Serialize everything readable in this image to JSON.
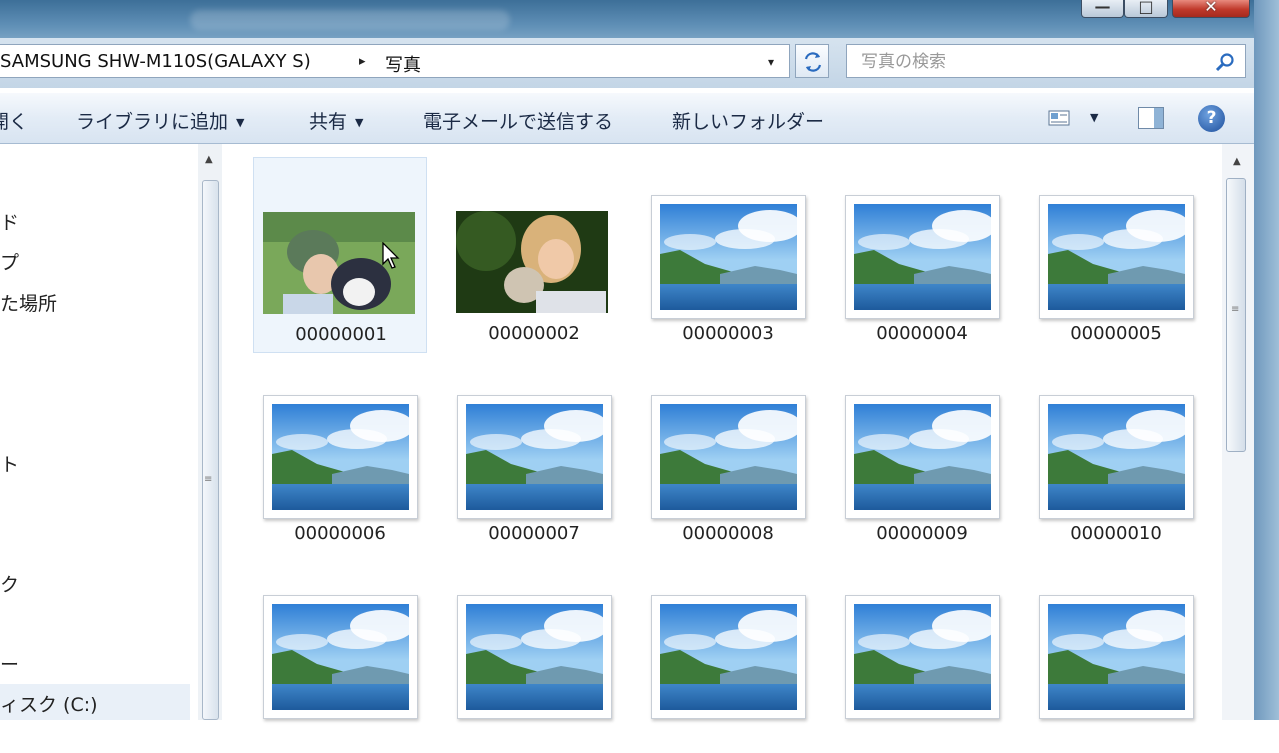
{
  "window": {
    "minimize_glyph": "—",
    "maximize_glyph": "□",
    "close_glyph": "✕"
  },
  "address": {
    "device": "SAMSUNG SHW-M110S(GALAXY S)",
    "separator": "▸",
    "folder": "写真",
    "dropdown": "▾"
  },
  "search": {
    "placeholder": "写真の検索"
  },
  "toolbar": {
    "open": "開く",
    "add_library": "ライブラリに追加",
    "share": "共有",
    "email": "電子メールで送信する",
    "new_folder": "新しいフォルダー",
    "dropdown_arrow": "▼",
    "help": "?"
  },
  "nav": {
    "items": [
      "ド",
      "プ",
      "た場所",
      "ト",
      "ク",
      "ー"
    ],
    "drive": "ィスク (C:)"
  },
  "files": [
    {
      "name": "00000001",
      "thumb": "photo-girl-dog"
    },
    {
      "name": "00000002",
      "thumb": "photo-girl-cat"
    },
    {
      "name": "00000003",
      "thumb": "landscape"
    },
    {
      "name": "00000004",
      "thumb": "landscape"
    },
    {
      "name": "00000005",
      "thumb": "landscape"
    },
    {
      "name": "00000006",
      "thumb": "landscape"
    },
    {
      "name": "00000007",
      "thumb": "landscape"
    },
    {
      "name": "00000008",
      "thumb": "landscape"
    },
    {
      "name": "00000009",
      "thumb": "landscape"
    },
    {
      "name": "00000010",
      "thumb": "landscape"
    },
    {
      "name": "",
      "thumb": "landscape"
    },
    {
      "name": "",
      "thumb": "landscape"
    },
    {
      "name": "",
      "thumb": "landscape"
    },
    {
      "name": "",
      "thumb": "landscape"
    },
    {
      "name": "",
      "thumb": "landscape"
    }
  ],
  "selected_file": "00000001",
  "colors": {
    "titlebar": "#5f8fb6",
    "toolbar_text": "#1b2a45",
    "selection": "#eef5fc",
    "close_button": "#c0392b"
  }
}
